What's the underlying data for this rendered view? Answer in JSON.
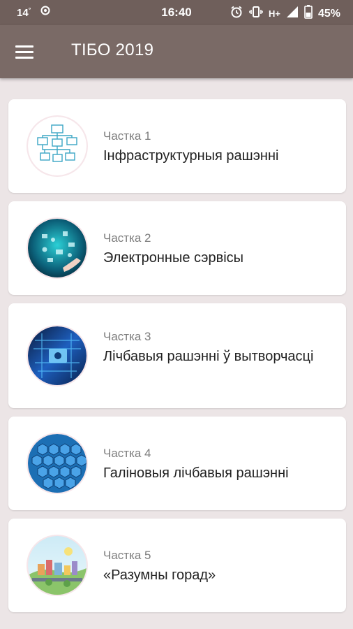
{
  "status": {
    "temperature": "14",
    "degree": "°",
    "time": "16:40",
    "network": "H+",
    "battery": "45%"
  },
  "app_bar": {
    "title": "ТІБО 2019",
    "menu_icon": "hamburger-menu-icon"
  },
  "colors": {
    "status_bar": "#6f5f5b",
    "app_bar": "#7a6a66",
    "background": "#ece5e6",
    "card": "#ffffff"
  },
  "items": [
    {
      "part": "Частка 1",
      "title": "Інфраструктурныя рашэнні",
      "image": "infrastructure-network-image"
    },
    {
      "part": "Частка 2",
      "title": "Электронные сэрвісы",
      "image": "electronic-services-image"
    },
    {
      "part": "Частка 3",
      "title": "Лічбавыя рашэнні ў вытворчасці",
      "image": "digital-production-image"
    },
    {
      "part": "Частка 4",
      "title": "Галіновыя лічбавыя рашэнні",
      "image": "hexagon-industry-image"
    },
    {
      "part": "Частка 5",
      "title": "«Разумны горад»",
      "image": "smart-city-image"
    }
  ]
}
